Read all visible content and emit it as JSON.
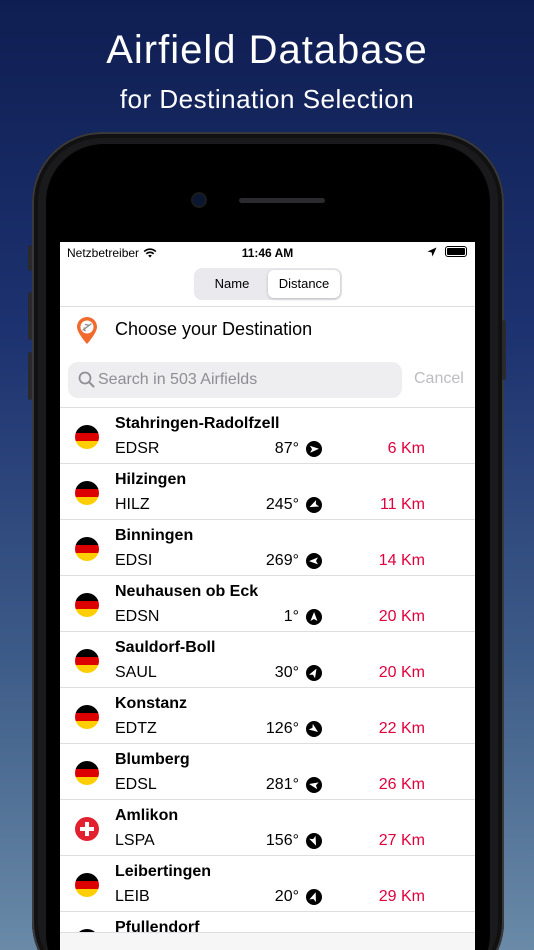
{
  "promo": {
    "title": "Airfield Database",
    "subtitle": "for Destination Selection"
  },
  "status_bar": {
    "carrier": "Netzbetreiber",
    "time": "11:46 AM"
  },
  "segmented": {
    "options": [
      "Name",
      "Distance"
    ],
    "selected": "Distance"
  },
  "header": {
    "title": "Choose your Destination"
  },
  "search": {
    "placeholder": "Search in 503 Airfields",
    "cancel_label": "Cancel"
  },
  "airfields": [
    {
      "name": "Stahringen-Radolfzell",
      "code": "EDSR",
      "bearing": "87°",
      "bearing_deg": 87,
      "distance": "6 Km",
      "country": "DE"
    },
    {
      "name": "Hilzingen",
      "code": "HILZ",
      "bearing": "245°",
      "bearing_deg": 245,
      "distance": "11 Km",
      "country": "DE"
    },
    {
      "name": "Binningen",
      "code": "EDSI",
      "bearing": "269°",
      "bearing_deg": 269,
      "distance": "14 Km",
      "country": "DE"
    },
    {
      "name": "Neuhausen ob Eck",
      "code": "EDSN",
      "bearing": "1°",
      "bearing_deg": 1,
      "distance": "20 Km",
      "country": "DE"
    },
    {
      "name": "Sauldorf-Boll",
      "code": "SAUL",
      "bearing": "30°",
      "bearing_deg": 30,
      "distance": "20 Km",
      "country": "DE"
    },
    {
      "name": "Konstanz",
      "code": "EDTZ",
      "bearing": "126°",
      "bearing_deg": 126,
      "distance": "22 Km",
      "country": "DE"
    },
    {
      "name": "Blumberg",
      "code": "EDSL",
      "bearing": "281°",
      "bearing_deg": 281,
      "distance": "26 Km",
      "country": "DE"
    },
    {
      "name": "Amlikon",
      "code": "LSPA",
      "bearing": "156°",
      "bearing_deg": 156,
      "distance": "27 Km",
      "country": "CH"
    },
    {
      "name": "Leibertingen",
      "code": "LEIB",
      "bearing": "20°",
      "bearing_deg": 20,
      "distance": "29 Km",
      "country": "DE"
    },
    {
      "name": "Pfullendorf",
      "code": "",
      "bearing": "",
      "bearing_deg": null,
      "distance": "",
      "country": "DE"
    }
  ],
  "colors": {
    "distance": "#e0003c",
    "accent_pin": "#f06a2c"
  }
}
